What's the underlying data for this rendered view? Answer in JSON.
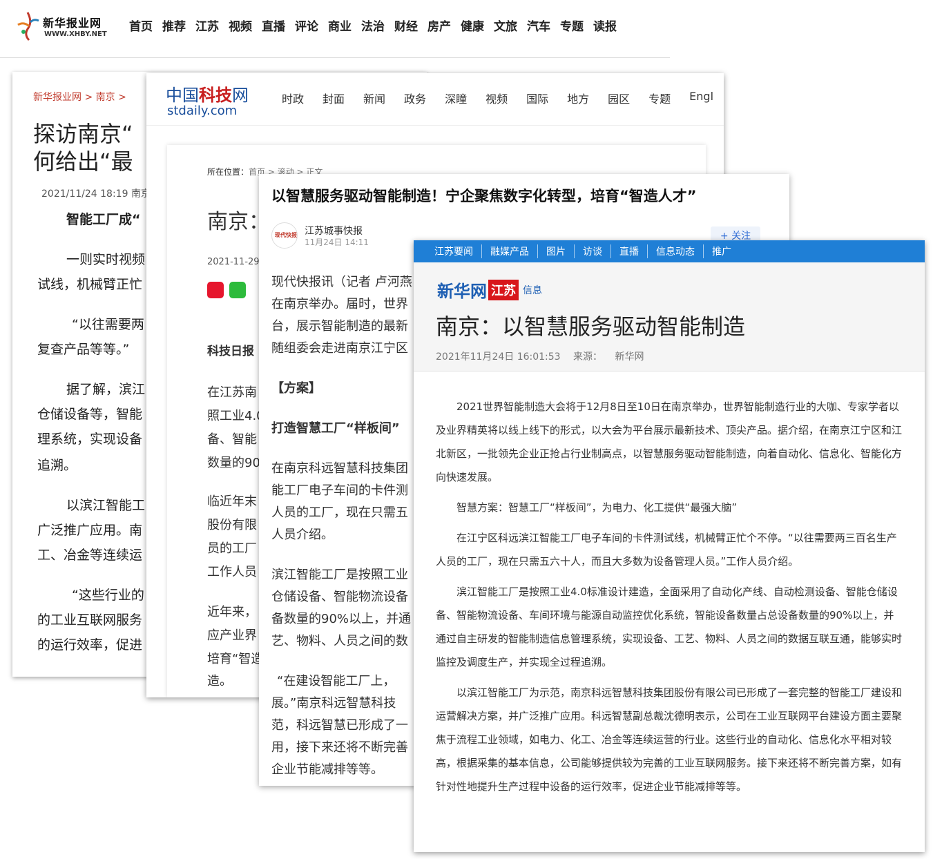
{
  "xhby_header": {
    "site_name": "新华报业网",
    "site_url": "WWW.XHBY.NET",
    "nav": [
      "首页",
      "推荐",
      "江苏",
      "视频",
      "直播",
      "评论",
      "商业",
      "法治",
      "财经",
      "房产",
      "健康",
      "文旅",
      "汽车",
      "专题",
      "读报"
    ]
  },
  "xhby_article": {
    "breadcrumb": "新华报业网 > 南京 > ",
    "title_line1": "探访南京“",
    "title_line2": "何给出“最",
    "meta": "2021/11/24 18:19  南京",
    "paragraphs": [
      "智能工厂成“",
      "一则实时视频",
      "试线，机械臂正忙",
      "“以往需要两",
      "复查产品等等。”",
      "据了解，滨江",
      "仓储设备等，智能",
      "理系统，实现设备",
      "追溯。",
      "以滨江智能工",
      "广泛推广应用。南",
      "工、冶金等连续运",
      "“这些行业的",
      "的工业互联网服务",
      "的运行效率，促进"
    ]
  },
  "stdaily": {
    "logo_cn_prefix": "中国",
    "logo_cn_red": "科技",
    "logo_cn_suffix": "网",
    "logo_en": "stdaily.com",
    "nav": [
      "时政",
      "封面",
      "新闻",
      "政务",
      "深瞳",
      "视频",
      "国际",
      "地方",
      "园区",
      "专题",
      "Engl"
    ],
    "location_label": "所在位置：",
    "location_path": "首页 > 滚动 > 正文",
    "title": "南京：",
    "date": "2021-11-29",
    "source": "科技日报",
    "paragraphs": [
      "在江苏南",
      "照工业4.0",
      "备、智能",
      "数量的90",
      "临近年末",
      "股份有限",
      "员的工厂",
      "工作人员",
      "近年来，",
      "应产业界",
      "培育“智造",
      "造。"
    ]
  },
  "xdkb": {
    "title": "以智慧服务驱动智能制造！宁企聚焦数字化转型，培育“智造人才”",
    "avatar_text": "现代快报",
    "author": "江苏城事快报",
    "time": "11月24日 14:11",
    "follow": "+ 关注",
    "lines": [
      "现代快报讯（记者 卢河燕",
      "在南京举办。届时，世界",
      "台，展示智能制造的最新",
      "随组委会走进南京江宁区"
    ],
    "heading1": "【方案】",
    "heading2": "打造智慧工厂“样板间”",
    "lines2": [
      "在南京科远智慧科技集团",
      "能工厂电子车间的卡件测",
      "人员的工厂，现在只需五",
      "人员介绍。"
    ],
    "lines3": [
      "滨江智能工厂是按照工业",
      "仓储设备、智能物流设备",
      "备数量的90%以上，并通",
      "艺、物料、人员之间的数"
    ],
    "lines4": [
      "“在建设智能工厂上，",
      "展。”南京科远智慧科技",
      "范，科远智慧已形成了一",
      "用，接下来还将不断完善",
      "企业节能减排等等。"
    ]
  },
  "xhnet": {
    "nav": [
      "江苏要闻",
      "融媒产品",
      "图片",
      "访谈",
      "直播",
      "信息动态",
      "推广"
    ],
    "brand": "新华网",
    "brand_region": "江苏",
    "brand_section": "信息",
    "title": "南京：以智慧服务驱动智能制造",
    "datetime": "2021年11月24日 16:01:53",
    "source_label": "来源：",
    "source": "新华网",
    "paragraphs": [
      "2021世界智能制造大会将于12月8日至10日在南京举办，世界智能制造行业的大咖、专家学者以及业界精英将以线上线下的形式，以大会为平台展示最新技术、顶尖产品。据介绍，在南京江宁区和江北新区，一批领先企业正抢占行业制高点，以智慧服务驱动智能制造，向着自动化、信息化、智能化方向快速发展。",
      "智慧方案：智慧工厂“样板间”，为电力、化工提供“最强大脑”",
      "在江宁区科远滨江智能工厂电子车间的卡件测试线，机械臂正忙个不停。“以往需要两三百名生产人员的工厂，现在只需五六十人，而且大多数为设备管理人员。”工作人员介绍。",
      "滨江智能工厂是按照工业4.0标准设计建造，全面采用了自动化产线、自动检测设备、智能仓储设备、智能物流设备、车间环境与能源自动监控优化系统，智能设备数量占总设备数量的90%以上，并通过自主研发的智能制造信息管理系统，实现设备、工艺、物料、人员之间的数据互联互通，能够实时监控及调度生产，并实现全过程追溯。",
      "以滨江智能工厂为示范，南京科远智慧科技集团股份有限公司已形成了一套完整的智能工厂建设和运营解决方案，并广泛推广应用。科远智慧副总裁沈德明表示，公司在工业互联网平台建设方面主要聚焦于流程工业领域，如电力、化工、冶金等连续运营的行业。这些行业的自动化、信息化水平相对较高，根据采集的基本信息，公司能够提供较为完善的工业互联网服务。接下来还将不断完善方案，如有针对性地提升生产过程中设备的运行效率，促进企业节能减排等等。"
    ]
  },
  "colors": {
    "xhby_red": "#c0392b",
    "stdaily_blue": "#1a4f9c",
    "xhnet_nav_blue": "#1f7fd6",
    "xhnet_brand_red": "#d8161b"
  }
}
